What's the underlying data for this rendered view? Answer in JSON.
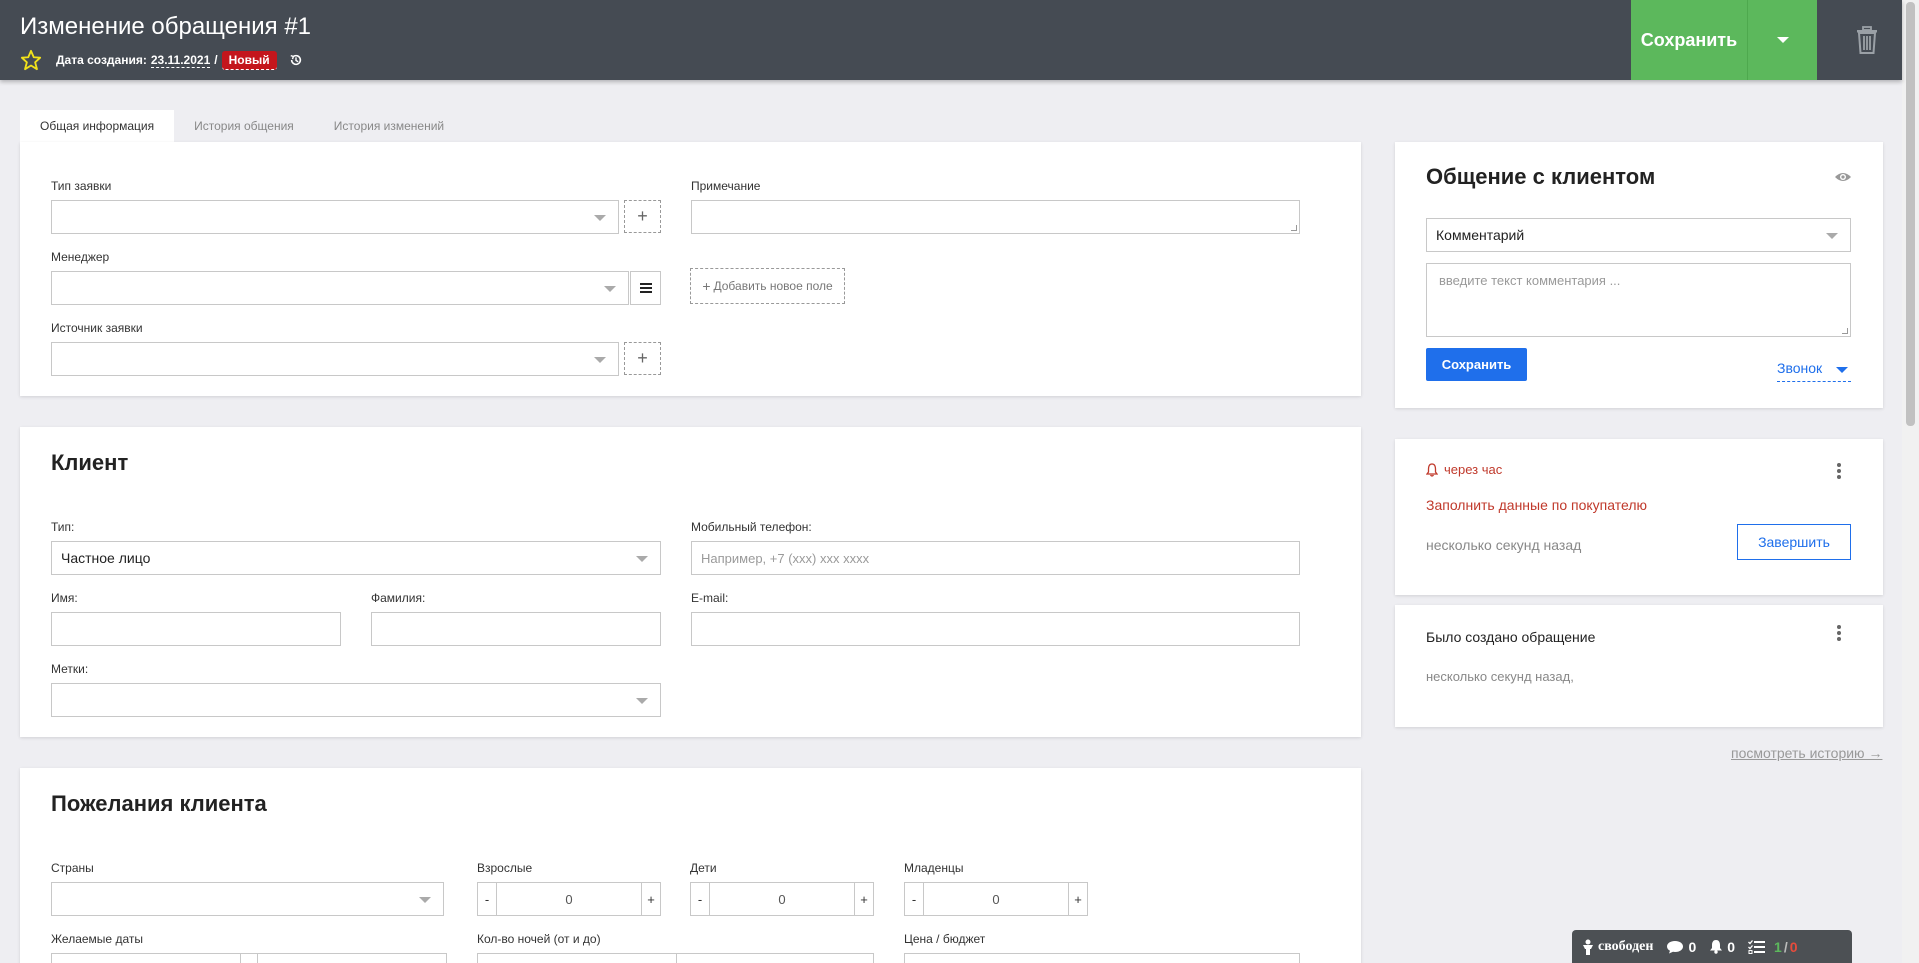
{
  "header": {
    "title": "Изменение обращения #1",
    "created_label": "Дата создания:",
    "created_date": "23.11.2021",
    "separator": "/",
    "status_badge": "Новый",
    "save_label": "Сохранить"
  },
  "tabs": [
    "Общая информация",
    "История общения",
    "История изменений"
  ],
  "general": {
    "request_type_label": "Тип заявки",
    "request_type_value": "",
    "manager_label": "Менеджер",
    "manager_value": "",
    "source_label": "Источник заявки",
    "source_value": "",
    "note_label": "Примечание",
    "note_value": "",
    "add_field_label": "Добавить новое поле"
  },
  "client": {
    "heading": "Клиент",
    "type_label": "Тип:",
    "type_value": "Частное лицо",
    "phone_label": "Мобильный телефон:",
    "phone_placeholder": "Например, +7 (xxx) xxx xxxx",
    "first_name_label": "Имя:",
    "last_name_label": "Фамилия:",
    "email_label": "E-mail:",
    "tags_label": "Метки:"
  },
  "wishes": {
    "heading": "Пожелания клиента",
    "countries_label": "Страны",
    "adults_label": "Взрослые",
    "adults_value": "0",
    "children_label": "Дети",
    "children_value": "0",
    "infants_label": "Младенцы",
    "infants_value": "0",
    "dates_label": "Желаемые даты",
    "nights_label": "Кол-во ночей (от и до)",
    "budget_label": "Цена / бюджет",
    "minus": "-",
    "plus": "+"
  },
  "comms": {
    "heading": "Общение с клиентом",
    "type_value": "Комментарий",
    "comment_placeholder": "введите текст комментария ...",
    "save_label": "Сохранить",
    "call_label": "Звонок"
  },
  "reminder": {
    "when": "через час",
    "task": "Заполнить данные по покупателю",
    "time": "несколько секунд назад",
    "complete_label": "Завершить"
  },
  "event": {
    "title": "Было создано обращение",
    "time": "несколько секунд назад,"
  },
  "history_link": "посмотреть историю →",
  "status_bar": {
    "status": "свободен",
    "messages": "0",
    "notifications": "0",
    "tasks_done": "1",
    "tasks_sep": "/",
    "tasks_total": "0"
  },
  "colors": {
    "header_bg": "#454b53",
    "save_green": "#5cb85c",
    "accent_blue": "#1f6feb",
    "badge_red": "#c4161c",
    "reminder_red": "#c0392b"
  }
}
